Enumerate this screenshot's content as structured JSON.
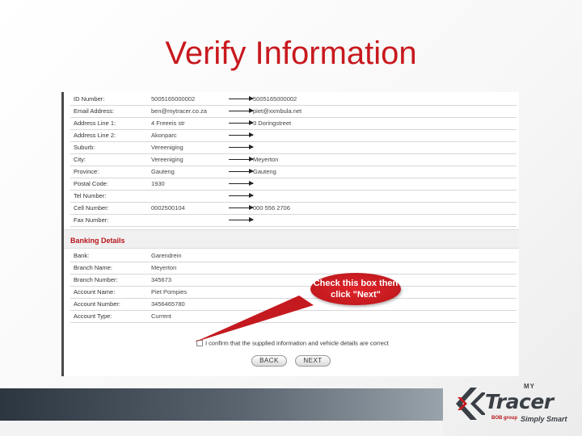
{
  "slide": {
    "title": "Verify Information"
  },
  "personal_rows": [
    {
      "label": "ID Number:",
      "value": "5005165000002",
      "arrow": true,
      "new": "5005165000002"
    },
    {
      "label": "Email Address:",
      "value": "ben@mytracer.co.za",
      "arrow": true,
      "new": "piet@xxmbula.net"
    },
    {
      "label": "Address Line 1:",
      "value": "4 Freeeis str",
      "arrow": true,
      "new": "3 Doringstreet"
    },
    {
      "label": "Address Line 2:",
      "value": "Akonparc",
      "arrow": true,
      "new": ""
    },
    {
      "label": "Suburb:",
      "value": "Vereeniging",
      "arrow": true,
      "new": ""
    },
    {
      "label": "City:",
      "value": "Vereeniging",
      "arrow": true,
      "new": "Meyerton"
    },
    {
      "label": "Province:",
      "value": "Gauteng",
      "arrow": true,
      "new": "Gauteng"
    },
    {
      "label": "Postal Code:",
      "value": "1930",
      "arrow": true,
      "new": ""
    },
    {
      "label": "Tel Number:",
      "value": "",
      "arrow": true,
      "new": ""
    },
    {
      "label": "Cell Number:",
      "value": "0002500104",
      "arrow": true,
      "new": "000 556 2706"
    },
    {
      "label": "Fax Number:",
      "value": "",
      "arrow": true,
      "new": ""
    }
  ],
  "banking": {
    "heading": "Banking Details",
    "rows": [
      {
        "label": "Bank:",
        "value": "Garendrein"
      },
      {
        "label": "Branch Name:",
        "value": "Meyerton"
      },
      {
        "label": "Branch Number:",
        "value": "345673"
      },
      {
        "label": "Account Name:",
        "value": "Piet Pompies"
      },
      {
        "label": "Account Number:",
        "value": "3456465780"
      },
      {
        "label": "Account Type:",
        "value": "Current"
      }
    ]
  },
  "confirm": {
    "text": "I confirm that the supplied information and vehicle details are correct"
  },
  "buttons": {
    "back": "BACK",
    "next": "NEXT"
  },
  "callout": {
    "line1": "Check this box then",
    "line2": "click \"Next\""
  },
  "brand": {
    "my": "MY",
    "name": "Tracer",
    "tagline": "Simply Smart",
    "sub": "BOB group",
    "colors": {
      "red": "#c8191e",
      "dark": "#3a3f45"
    }
  }
}
